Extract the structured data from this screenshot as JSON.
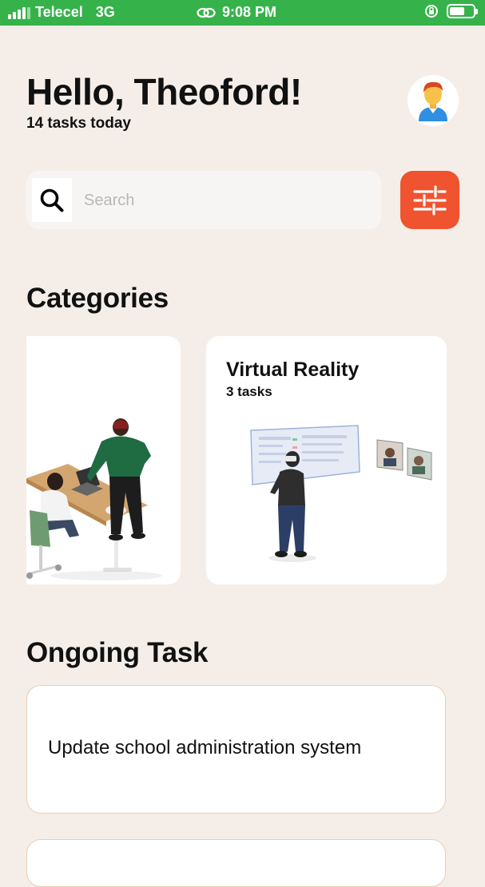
{
  "status_bar": {
    "carrier": "Telecel",
    "network": "3G",
    "time": "9:08 PM"
  },
  "header": {
    "greeting": "Hello, Theoford!",
    "subtitle": "14 tasks today",
    "avatar_icon": "user-avatar-icon"
  },
  "search": {
    "placeholder": "Search",
    "value": "",
    "icon": "search-icon",
    "filter_icon": "sliders-icon",
    "filter_color": "#f0532f"
  },
  "categories": {
    "title": "Categories",
    "items": [
      {
        "title": "",
        "count": ""
      },
      {
        "title": "Virtual Reality",
        "count": "3 tasks"
      }
    ]
  },
  "ongoing": {
    "title": "Ongoing Task",
    "tasks": [
      {
        "title": "Update school administration system"
      },
      {
        "title": ""
      }
    ]
  },
  "colors": {
    "background": "#f5eee8",
    "status_bar": "#35b34a",
    "accent": "#f0532f",
    "task_border": "#e6cfb4"
  }
}
